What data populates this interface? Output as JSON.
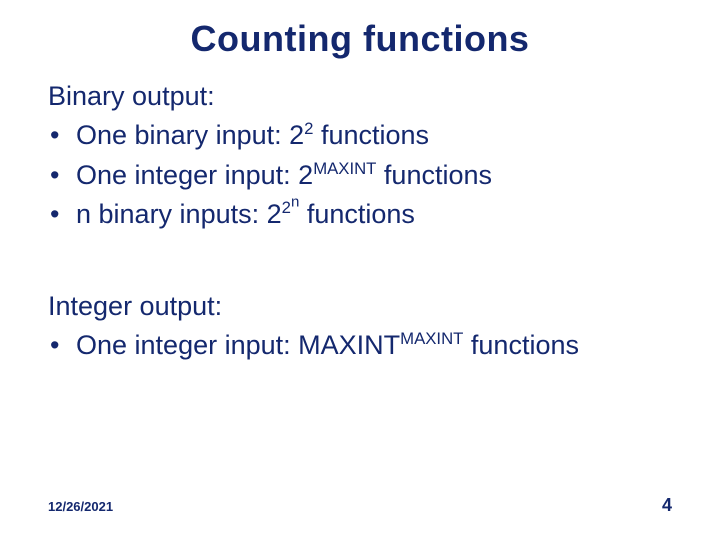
{
  "title": "Counting functions",
  "sections": [
    {
      "heading": "Binary output:",
      "items": [
        {
          "prefix": "One binary input: ",
          "base": "2",
          "exp": "2",
          "suffix": " functions",
          "nested": false
        },
        {
          "prefix": "One integer input: ",
          "base": "2",
          "exp": "MAXINT",
          "suffix": " functions",
          "nested": false
        },
        {
          "prefix": "n binary inputs: ",
          "base": "2",
          "exp": "2",
          "exp2": "n",
          "suffix": " functions",
          "nested": true
        }
      ]
    },
    {
      "heading": "Integer output:",
      "items": [
        {
          "prefix": "One integer input: ",
          "base": "MAXINT",
          "exp": "MAXINT",
          "suffix": " functions",
          "nested": false
        }
      ]
    }
  ],
  "footer": {
    "date": "12/26/2021",
    "page": "4"
  },
  "bullet_char": "•"
}
